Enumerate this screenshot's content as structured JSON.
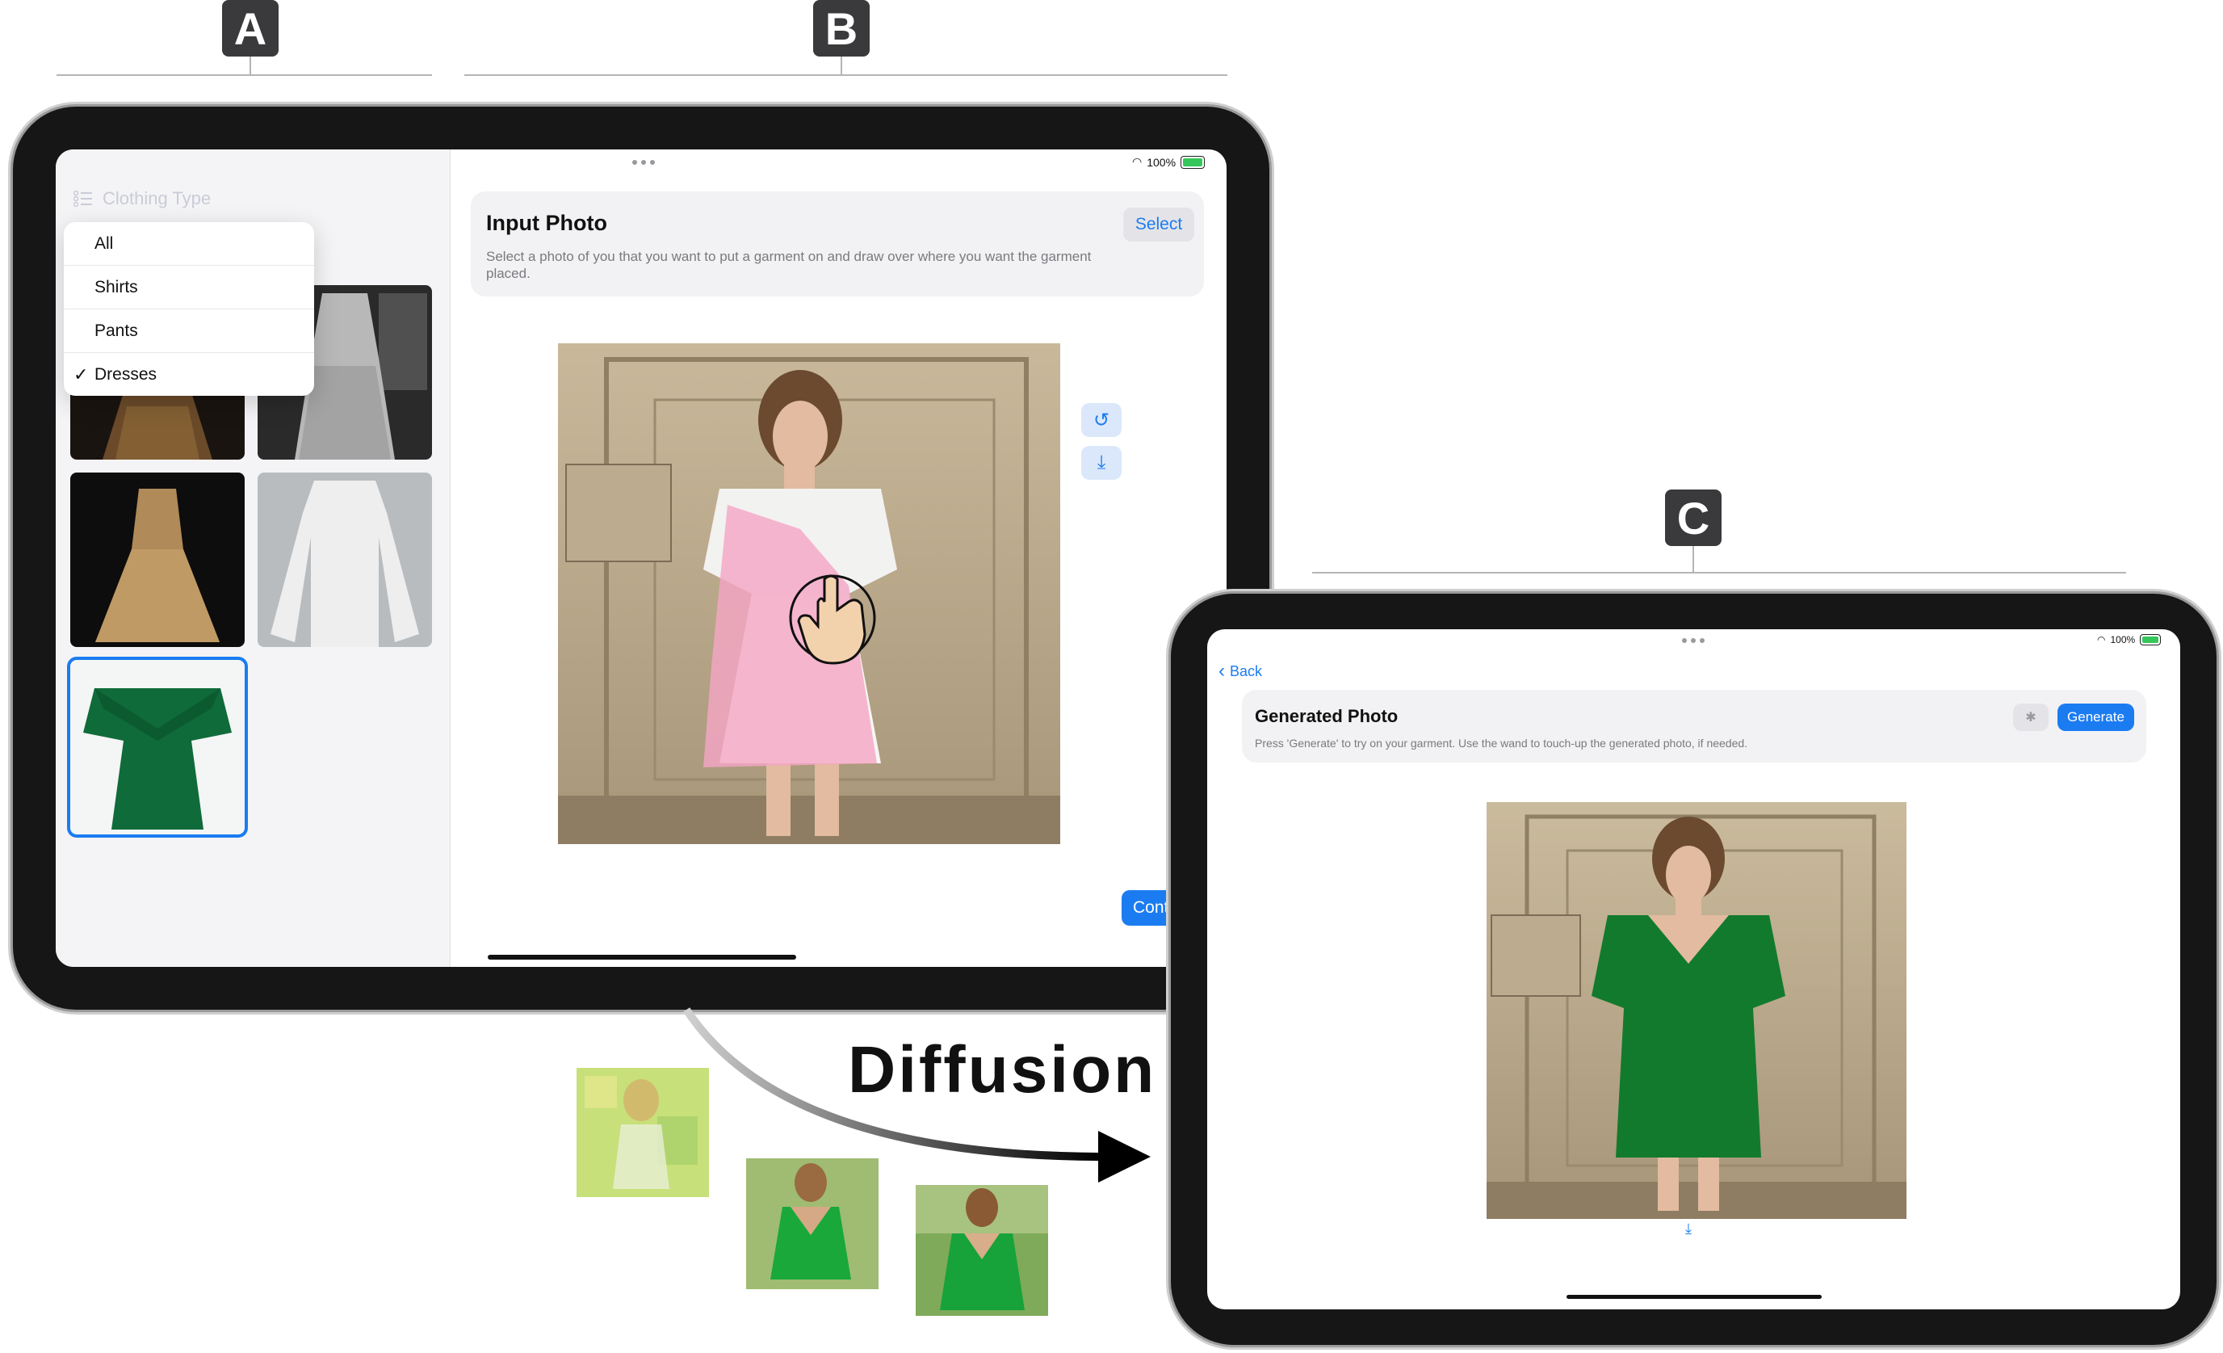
{
  "labels": {
    "a": "A",
    "b": "B",
    "c": "C"
  },
  "ipad1": {
    "sidebar": {
      "header": "Clothing Type",
      "menu": [
        {
          "label": "All",
          "checked": false
        },
        {
          "label": "Shirts",
          "checked": false
        },
        {
          "label": "Pants",
          "checked": false
        },
        {
          "label": "Dresses",
          "checked": true
        }
      ],
      "check_glyph": "✓"
    },
    "status": {
      "battery": "100%"
    },
    "input_card": {
      "title": "Input Photo",
      "select_label": "Select",
      "description": "Select a photo of you that you want to put a garment on and draw over where you want the garment placed."
    },
    "tools": {
      "undo_icon": "↺",
      "save_icon": "⤓"
    },
    "continue_label": "Conti"
  },
  "diffusion": {
    "label": "Diffusion"
  },
  "ipad2": {
    "status": {
      "battery": "100%"
    },
    "back_label": "Back",
    "card": {
      "title": "Generated Photo",
      "generate_label": "Generate",
      "wand_icon": "✱",
      "description": "Press 'Generate' to try on your garment. Use the wand to touch-up the generated photo, if needed."
    },
    "save_icon": "⤓"
  },
  "colors": {
    "accent": "#1b7cf1",
    "mask": "#f4a6c4",
    "dress": "#0f7a2e"
  }
}
